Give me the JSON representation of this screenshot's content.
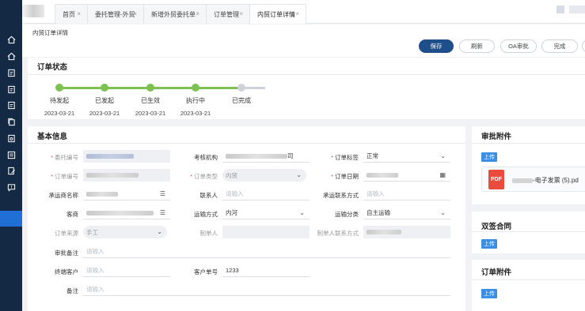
{
  "tabs": [
    {
      "label": "首页"
    },
    {
      "label": "委托管理-外贸"
    },
    {
      "label": "新增外贸委托单"
    },
    {
      "label": "订单管理"
    },
    {
      "label": "内贸订单详情"
    }
  ],
  "breadcrumb": "内贸订单详情",
  "actions": {
    "save": "保存",
    "refresh": "刷新",
    "oa": "OA审批",
    "complete": "完成"
  },
  "order_status": {
    "title": "订单状态",
    "steps": [
      {
        "label": "待发起",
        "date": "2023-03-21",
        "state": "done"
      },
      {
        "label": "已发起",
        "date": "2023-03-21",
        "state": "done"
      },
      {
        "label": "已生效",
        "date": "2023-03-21",
        "state": "done"
      },
      {
        "label": "执行中",
        "date": "2023-03-21",
        "state": "done"
      },
      {
        "label": "已完成",
        "date": "",
        "state": "pending"
      }
    ]
  },
  "basic_info": {
    "title": "基本信息",
    "labels": {
      "entrust_no": "委托编号",
      "assess_org": "考核机构",
      "order_tag": "订单标签",
      "order_no": "订单编号",
      "order_type": "订单类型",
      "order_date": "订单日期",
      "carrier": "承运商名称",
      "contact": "联系人",
      "carrier_contact": "承运联系方式",
      "customer": "客商",
      "transport_mode": "运输方式",
      "transport_class": "运输分类",
      "order_source": "订单来源",
      "creator": "制单人",
      "creator_contact": "制单人联系方式",
      "approval_note": "审批备注",
      "end_customer": "终端客户",
      "customer_order_no": "客户单号",
      "remark": "备注"
    },
    "values": {
      "assess_org_suffix": "司",
      "order_tag": "正常",
      "order_type": "内贸",
      "transport_mode": "内河",
      "transport_class": "自主运输",
      "order_source": "手工",
      "customer_order_no": "1233"
    },
    "placeholder": "请输入"
  },
  "approval_attachments": {
    "title": "审批附件",
    "upload": "上传",
    "file_suffix": "-电子发票 (5).pd",
    "file_icon": "PDF"
  },
  "dual_contract": {
    "title": "双签合同",
    "upload": "上传"
  },
  "order_attachments": {
    "title": "订单附件",
    "upload": "上传"
  },
  "colors": {
    "sidebar": "#142a44",
    "primary": "#1f4f8b",
    "step_done": "#7cc152",
    "step_pending": "#cfd3d8",
    "upload": "#3b8ee6",
    "required": "#e34d59"
  }
}
